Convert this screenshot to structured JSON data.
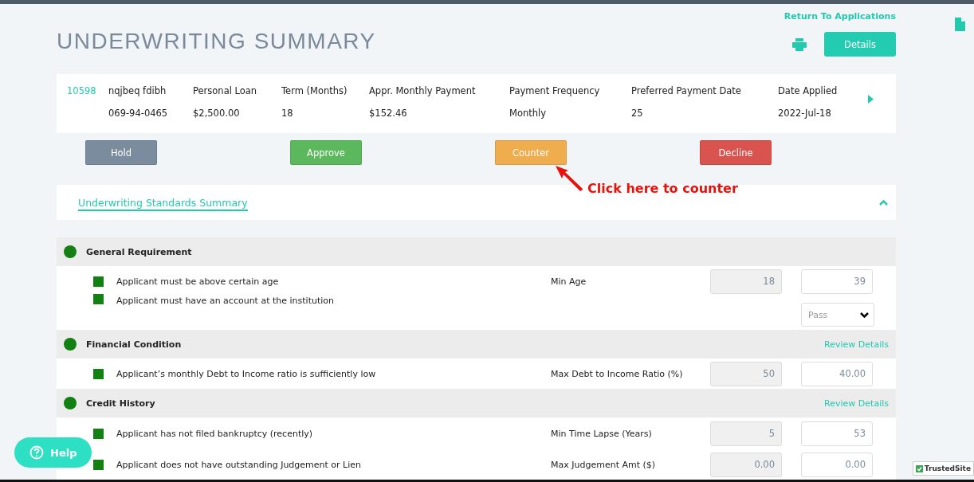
{
  "header": {
    "return_link": "Return To Applications",
    "title": "UNDERWRITING SUMMARY",
    "details_button": "Details"
  },
  "application": {
    "id": "10598",
    "name": "nqjbeq fdibh",
    "ssn": "069-94-0465",
    "fields": [
      {
        "label": "Personal Loan",
        "value": "$2,500.00"
      },
      {
        "label": "Term (Months)",
        "value": "18"
      },
      {
        "label": "Appr. Monthly Payment",
        "value": "$152.46"
      },
      {
        "label": "Payment Frequency",
        "value": "Monthly"
      },
      {
        "label": "Preferred Payment Date",
        "value": "25"
      },
      {
        "label": "Date Applied",
        "value": "2022-Jul-18"
      }
    ]
  },
  "actions": [
    {
      "label": "Hold",
      "kind": "hold"
    },
    {
      "label": "Approve",
      "kind": "approve"
    },
    {
      "label": "Counter",
      "kind": "counter"
    },
    {
      "label": "Decline",
      "kind": "decline"
    }
  ],
  "annotation": "Click here to counter",
  "standards": {
    "title": "Underwriting Standards Summary",
    "expanded": true,
    "groups": [
      {
        "title": "General Requirement",
        "passed": true,
        "items": [
          {
            "text": "Applicant must be above certain age",
            "passed": true,
            "kind": "number",
            "label": "Min Age",
            "standard": "18",
            "value": "39"
          },
          {
            "text": "Applicant must have an account at the institution",
            "passed": true,
            "kind": "select",
            "value": "Pass"
          }
        ]
      },
      {
        "title": "Financial Condition",
        "passed": true,
        "link": "Review Details",
        "items": [
          {
            "text": "Applicant’s monthly Debt to Income ratio is sufficiently low",
            "passed": true,
            "kind": "number",
            "label": "Max Debt to Income Ratio (%)",
            "standard": "50",
            "value": "40.00"
          }
        ]
      },
      {
        "title": "Credit History",
        "passed": true,
        "link": "Review Details",
        "items": [
          {
            "text": "Applicant has not filed bankruptcy (recently)",
            "passed": true,
            "kind": "number",
            "label": "Min Time Lapse (Years)",
            "standard": "5",
            "value": "53"
          },
          {
            "text": "Applicant does not have outstanding Judgement or Lien",
            "passed": true,
            "kind": "number",
            "label": "Max Judgement Amt ($)",
            "standard": "0.00",
            "value": "0.00"
          }
        ]
      }
    ]
  },
  "help_button": "Help",
  "trust_badge": "TrustedSite"
}
